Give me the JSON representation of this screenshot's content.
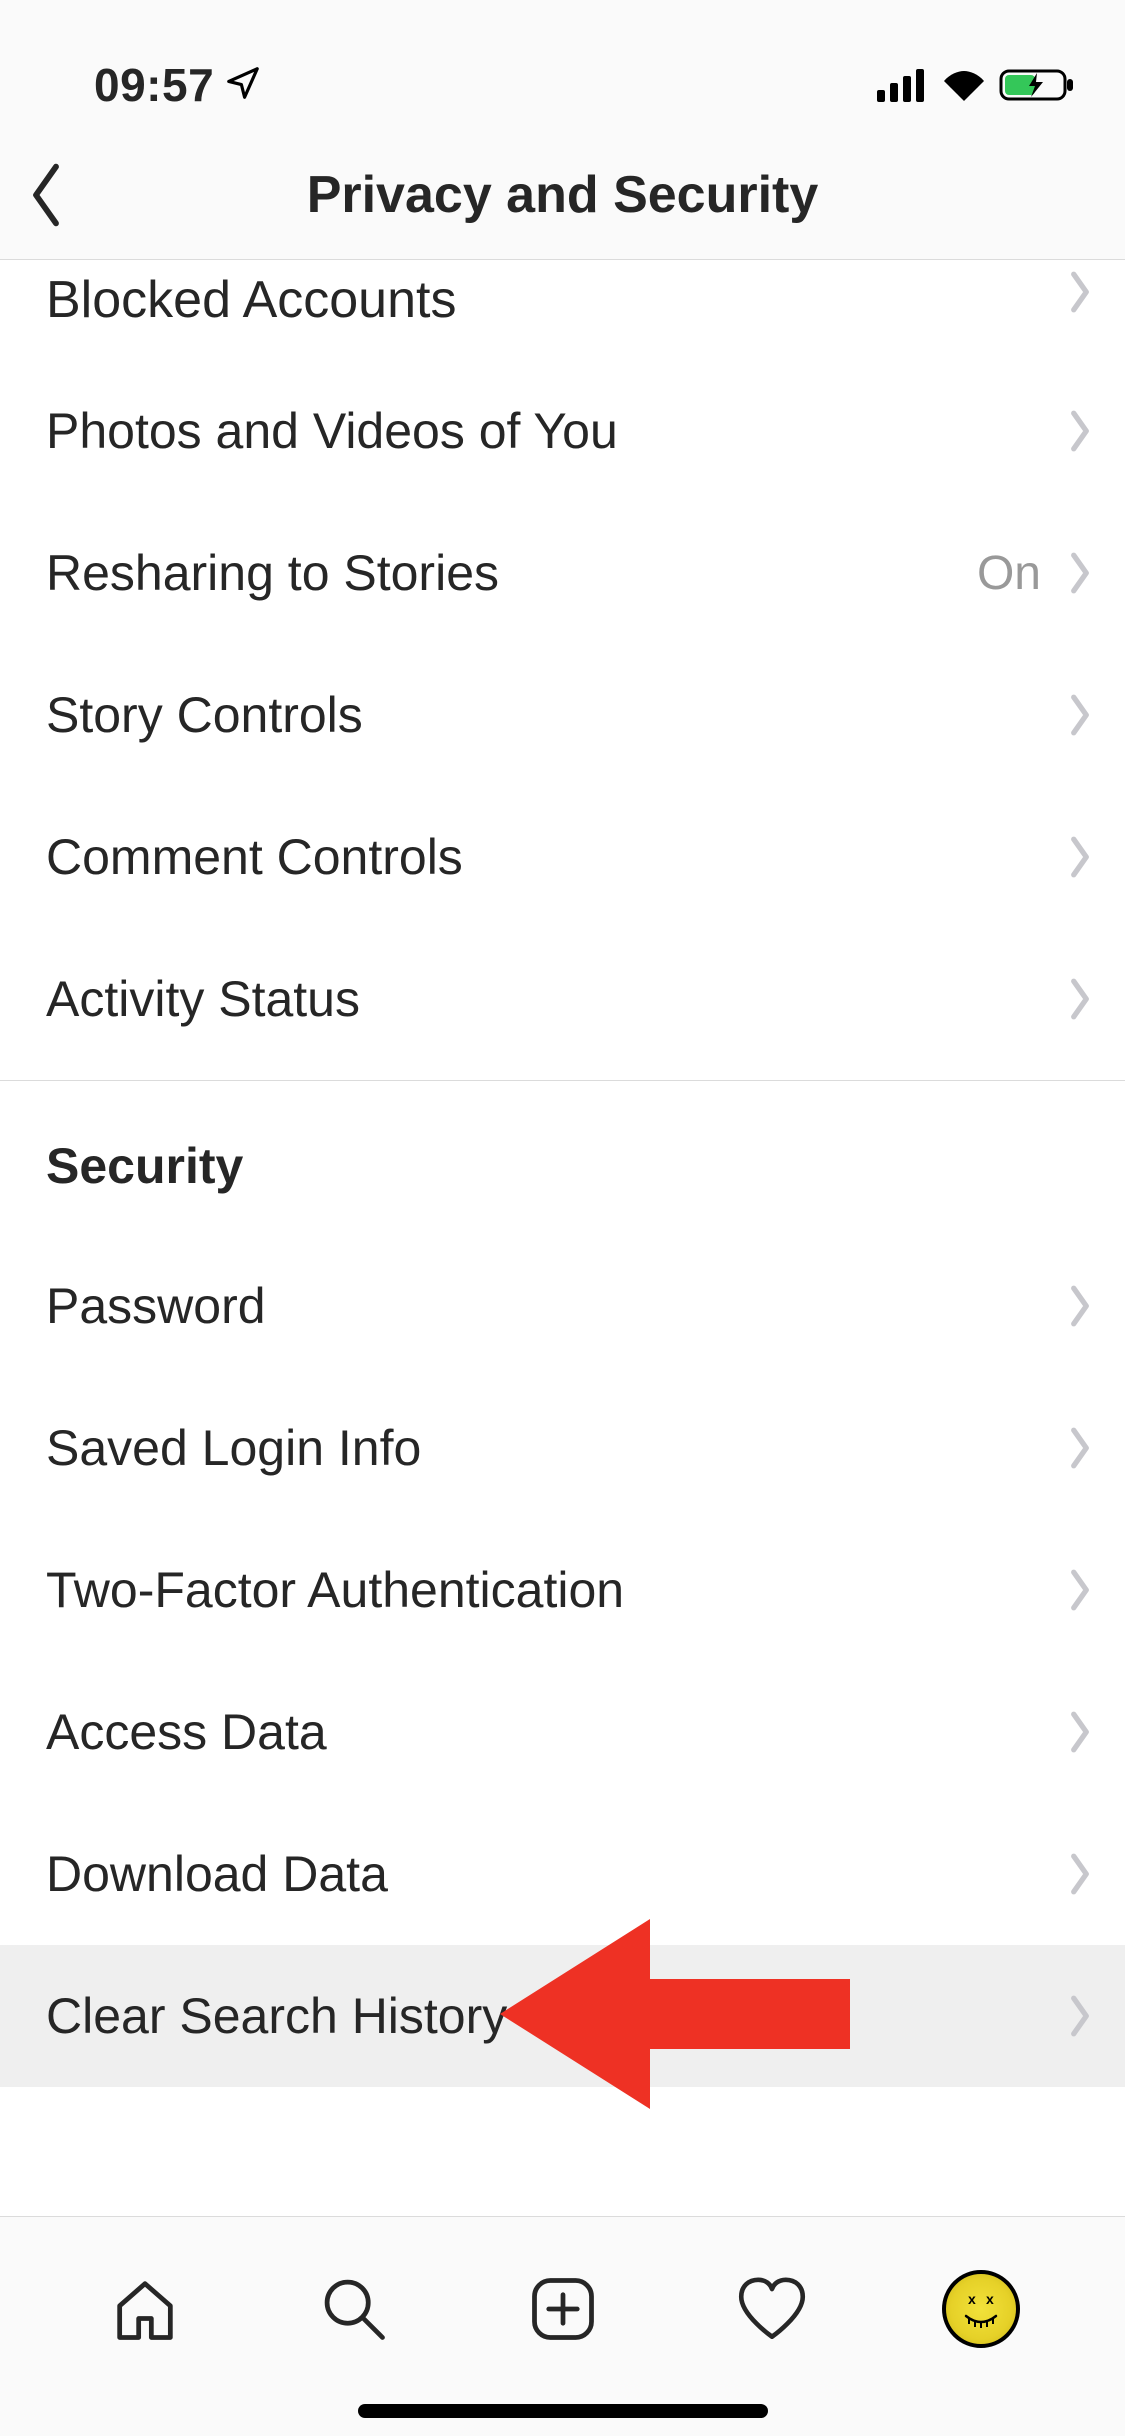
{
  "status": {
    "time": "09:57"
  },
  "header": {
    "title": "Privacy and Security"
  },
  "rows": {
    "blocked": {
      "label": "Blocked Accounts"
    },
    "photos": {
      "label": "Photos and Videos of You"
    },
    "resharing": {
      "label": "Resharing to Stories",
      "value": "On"
    },
    "story": {
      "label": "Story Controls"
    },
    "comment": {
      "label": "Comment Controls"
    },
    "activity": {
      "label": "Activity Status"
    }
  },
  "section": {
    "security": "Security"
  },
  "security_rows": {
    "password": {
      "label": "Password"
    },
    "login": {
      "label": "Saved Login Info"
    },
    "twofa": {
      "label": "Two-Factor Authentication"
    },
    "access": {
      "label": "Access Data"
    },
    "download": {
      "label": "Download Data"
    },
    "clear": {
      "label": "Clear Search History"
    }
  }
}
